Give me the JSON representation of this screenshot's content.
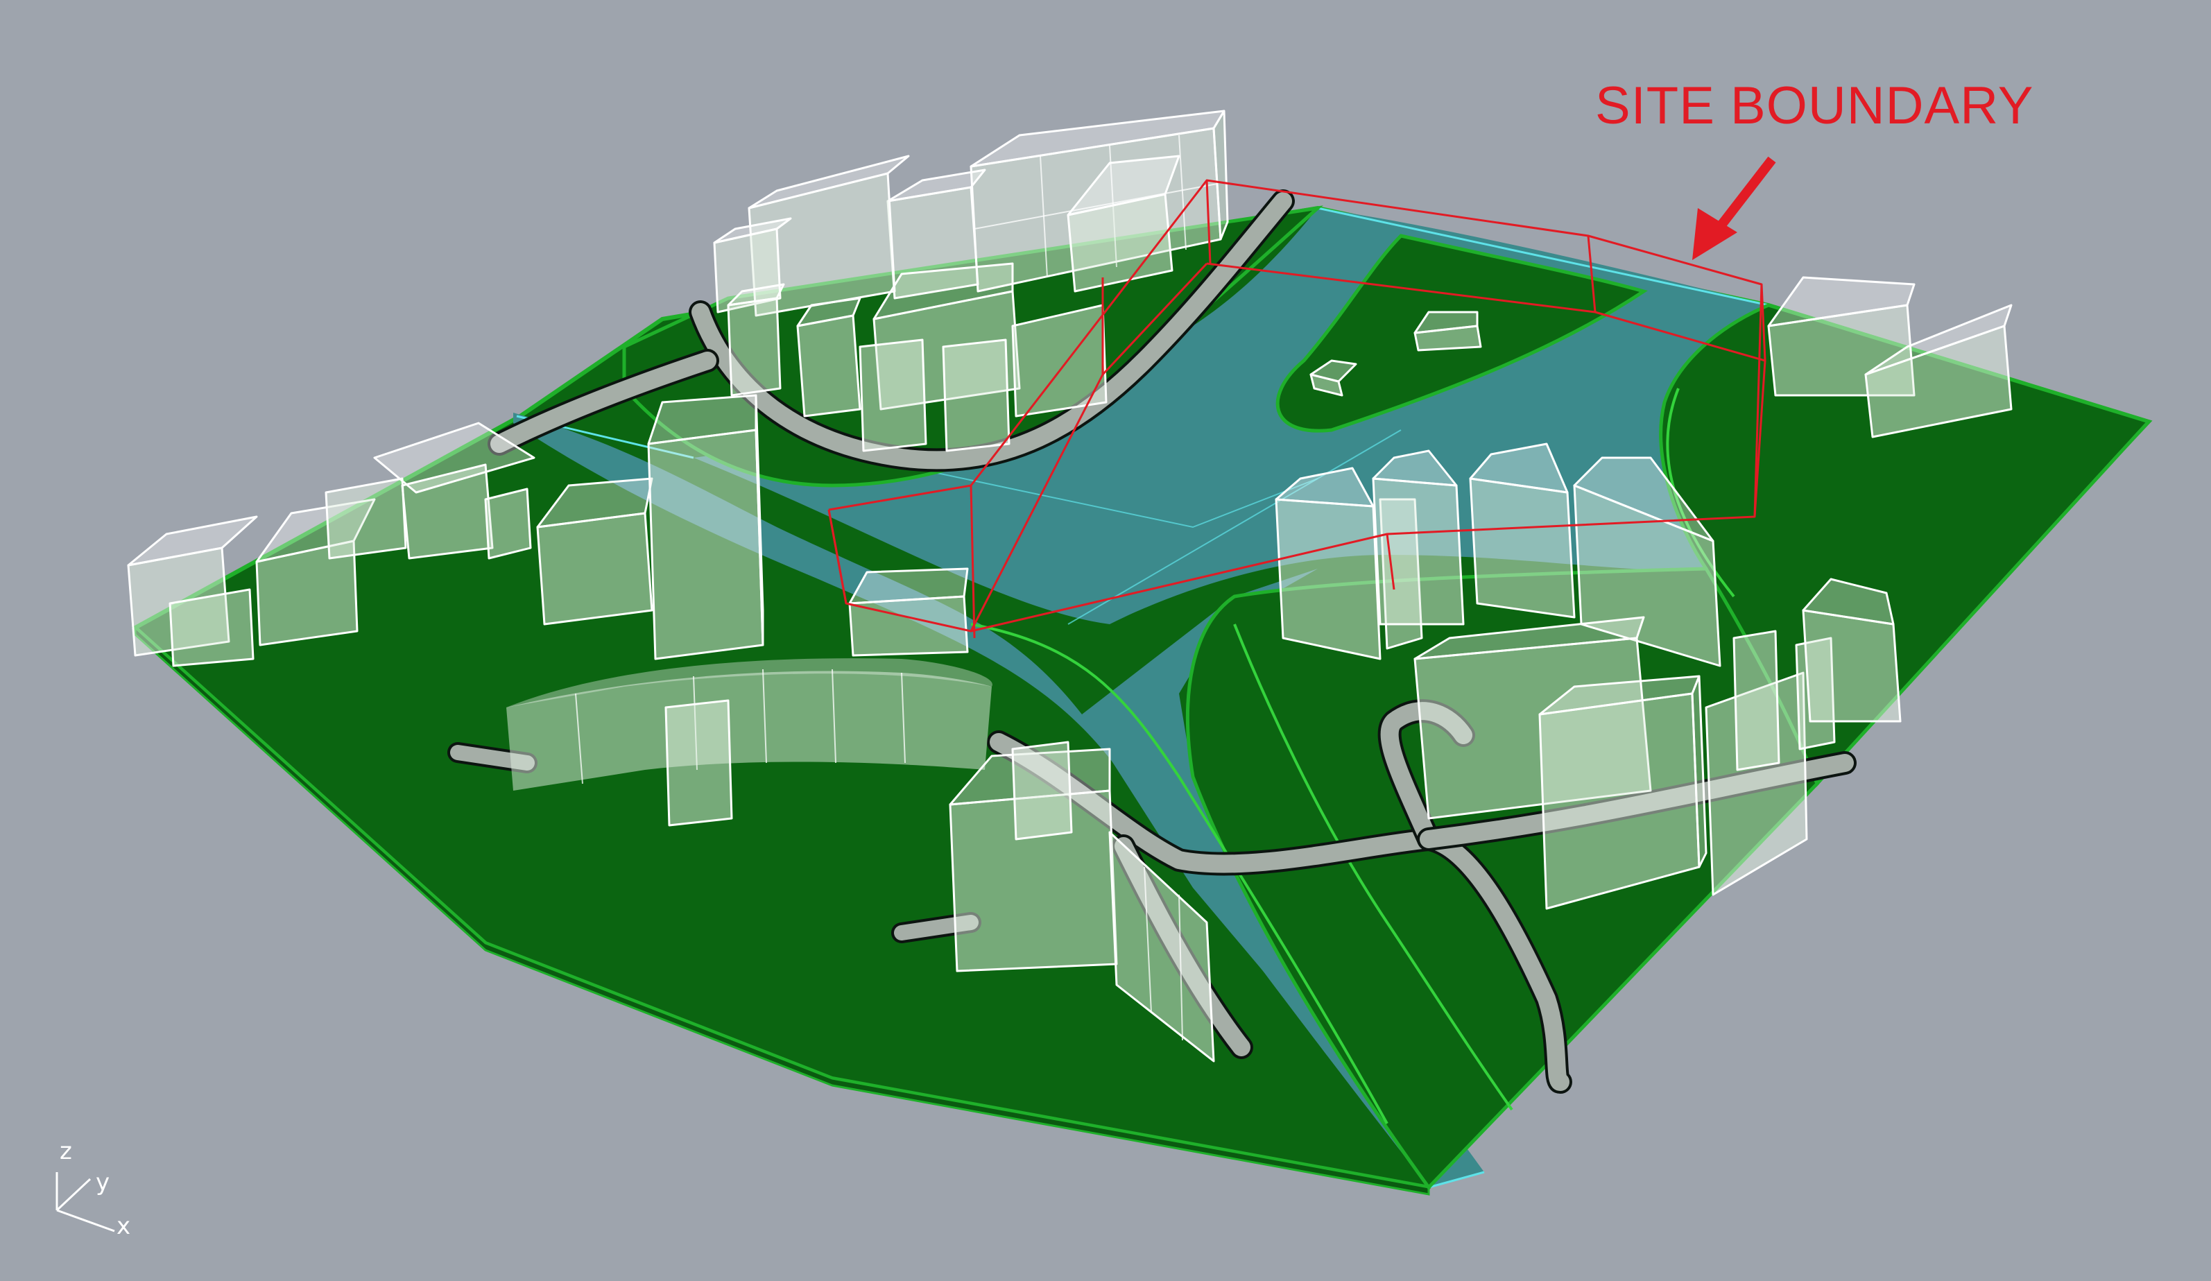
{
  "annotation": {
    "label": "SITE BOUNDARY"
  },
  "axes": {
    "z": "z",
    "y": "y",
    "x": "x"
  },
  "colors": {
    "background": "#9ea4ad",
    "ground": "#0b6511",
    "ground_edge": "#1fb02a",
    "water": "#3c8a8c",
    "road": "#a5aea7",
    "road_edge": "#0c1410",
    "building_edge": "#ffffff",
    "site_boundary": "#e21b24",
    "water_edge": "#5ee2e8"
  }
}
